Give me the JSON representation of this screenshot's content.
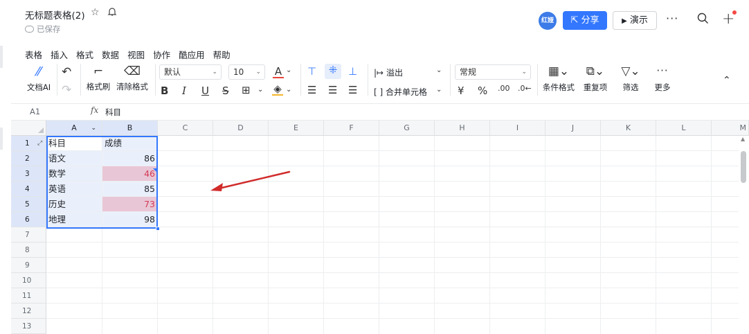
{
  "header": {
    "title": "无标题表格(2)",
    "saved_status": "已保存",
    "avatar_text": "红娅",
    "share_label": "分享",
    "present_label": "演示"
  },
  "menu": [
    "表格",
    "插入",
    "格式",
    "数据",
    "视图",
    "协作",
    "酷应用",
    "帮助"
  ],
  "toolbar": {
    "ai_label": "文档AI",
    "format_painter_label": "格式刷",
    "clear_format_label": "清除格式",
    "font_family": "默认",
    "font_size": "10",
    "overflow_label": "溢出",
    "merge_label": "合并单元格",
    "number_format": "常规",
    "currency_symbol": "¥",
    "percent_symbol": "%",
    "cond_format_label": "条件格式",
    "duplicates_label": "重复项",
    "filter_label": "筛选",
    "more_label": "更多"
  },
  "formula_bar": {
    "cell_ref": "A1",
    "fx_label": "fx",
    "content": "科目"
  },
  "columns": [
    "A",
    "B",
    "C",
    "D",
    "E",
    "F",
    "G",
    "H",
    "I",
    "J",
    "K",
    "L",
    "M"
  ],
  "rows": [
    "1",
    "2",
    "3",
    "4",
    "5",
    "6",
    "7",
    "8",
    "9",
    "10",
    "11",
    "12",
    "13"
  ],
  "table": [
    {
      "a": "科目",
      "b": "成绩"
    },
    {
      "a": "语文",
      "b": "86"
    },
    {
      "a": "数学",
      "b": "46"
    },
    {
      "a": "英语",
      "b": "85"
    },
    {
      "a": "历史",
      "b": "73"
    },
    {
      "a": "地理",
      "b": "98"
    }
  ],
  "colors": {
    "accent": "#3377ff",
    "highlight_fill": "#e8c6d5",
    "highlight_text": "#d43a56",
    "arrow": "#d12b2b"
  }
}
